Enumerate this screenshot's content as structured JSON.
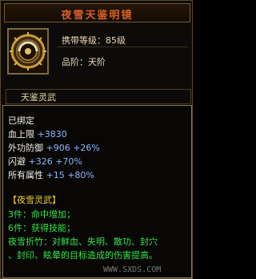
{
  "title": "夜雪天鉴明镜",
  "header": {
    "level_label": "携带等级：",
    "level_value": "85级",
    "grade_label": "品阶：",
    "grade_value": "天阶"
  },
  "item_name": "天鉴灵武",
  "stats": {
    "bound": "已绑定",
    "hp_label": "血上限",
    "hp_value": "+3830",
    "ext_def_label": "外功防御",
    "ext_def_value": "+906",
    "ext_def_pct": "+26%",
    "dodge_label": "闪避",
    "dodge_value": "+326",
    "dodge_pct": "+70%",
    "all_attr_label": "所有属性",
    "all_attr_value": "+15",
    "all_attr_pct": "+80%"
  },
  "set": {
    "name": "【夜雪灵武】",
    "piece3": "3件：命中增加；",
    "piece6": "6件：获得技能；",
    "skill_line1": "夜雪折竹：对鲜血、失明、散功、封穴",
    "skill_line2": "、封印、眩晕的目标造成的伤害提高。"
  },
  "watermark": "WWW.SXDS.COM",
  "colors": {
    "title": "#d7602a",
    "stat_blue": "#8fb6ff",
    "set_yellow": "#f1cc3a",
    "set_green": "#36e24a"
  },
  "icon": "mirror-item-icon"
}
